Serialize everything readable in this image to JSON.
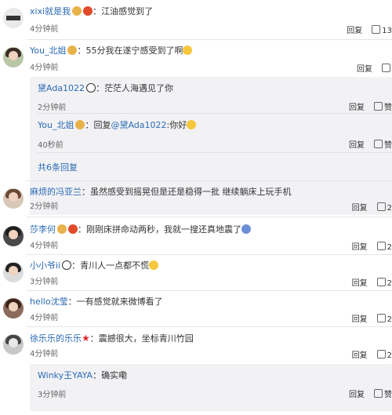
{
  "comments": [
    {
      "user": "xixi就是我",
      "text": "江油感觉到了",
      "time": "4分钟前",
      "reply_label": "回复",
      "like_label": "13"
    },
    {
      "user": "You_北姐",
      "text": "55分我在遂宁感受到了啊",
      "time": "4分钟前",
      "reply_label": "回复",
      "replies": [
        {
          "user": "黛Ada1022",
          "text": "茫茫人海遇见了你",
          "time": "2分钟前",
          "reply_label": "回复",
          "like_label": "赞"
        },
        {
          "user": "You_北姐",
          "prefix": "回复",
          "mention": "@黛Ada1022",
          "text": ":你好",
          "time": "40秒前",
          "reply_label": "回复",
          "like_label": "赞"
        }
      ],
      "expand_label": "共6条回复"
    },
    {
      "user": "麻烦的冯亚兰",
      "text": "虽然感受到摇晃但是还是稳得一批 继续躺床上玩手机",
      "time": "2分钟前",
      "reply_label": "回复",
      "like_label": "2"
    },
    {
      "user": "莎李何",
      "text": "刚刚床拼命动两秒，我就一搜还真地震了",
      "time": "4分钟前",
      "reply_label": "回复",
      "like_label": "2"
    },
    {
      "user": "小小爷ii",
      "text": "青川人一点都不慌",
      "time": "3分钟前",
      "reply_label": "回复",
      "like_label": "2"
    },
    {
      "user": "hello沈莹",
      "text": "一有感觉就来微博看了",
      "time": "4分钟前",
      "reply_label": "回复",
      "like_label": "2"
    },
    {
      "user": "徐乐乐的乐乐",
      "text": "震撼很大，坐标青川竹园",
      "time": "4分钟前",
      "reply_label": "回复",
      "like_label": "2",
      "replies": [
        {
          "user": "Winky王YAYA",
          "text": "确实嘞",
          "time": "3分钟前",
          "reply_label": "回复",
          "like_label": "赞"
        }
      ]
    }
  ],
  "colors": {
    "link": "#2a6ab3",
    "reply_bg": "#f2f2f5"
  }
}
